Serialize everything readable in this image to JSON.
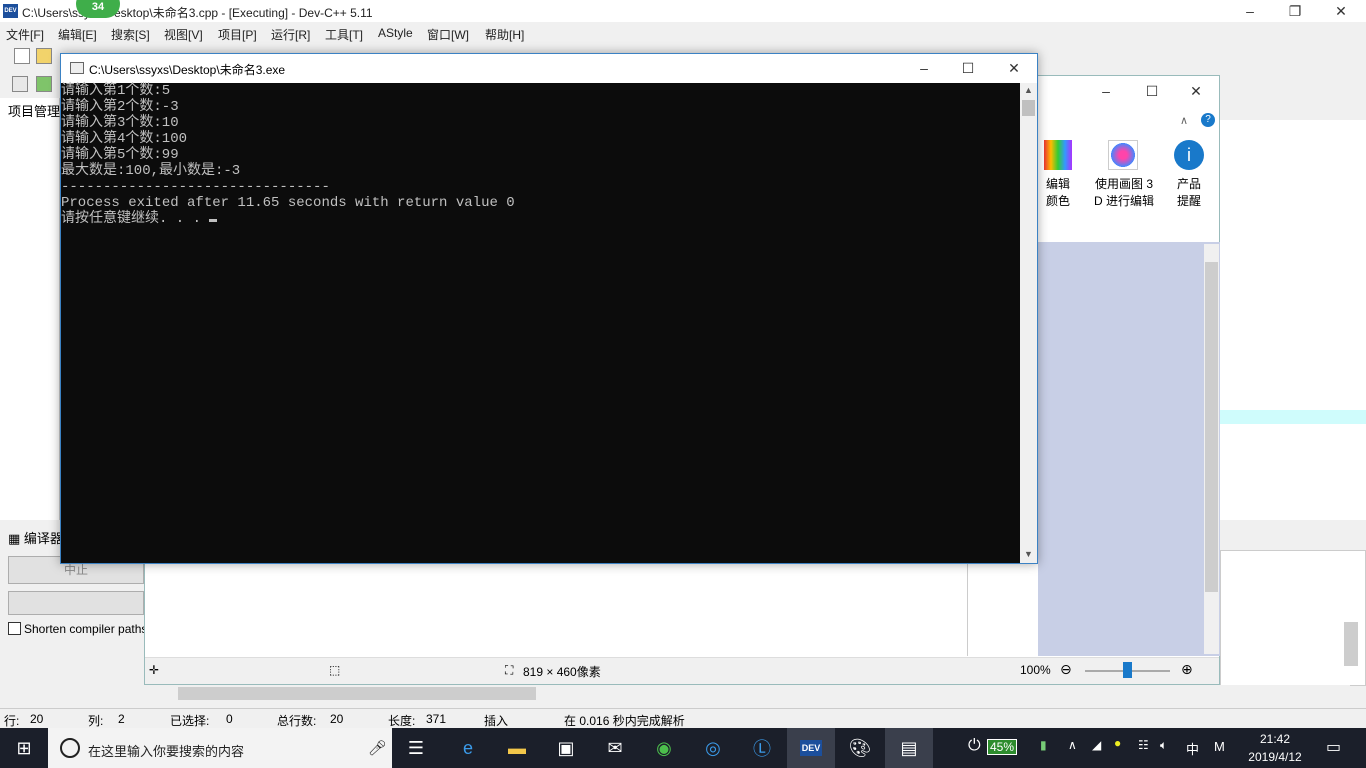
{
  "devcpp": {
    "title": "C:\\Users\\ssyxs\\Desktop\\未命名3.cpp - [Executing] - Dev-C++ 5.11",
    "badge": "34",
    "menu": [
      "文件[F]",
      "编辑[E]",
      "搜索[S]",
      "视图[V]",
      "项目[P]",
      "运行[R]",
      "工具[T]",
      "AStyle",
      "窗口[W]",
      "帮助[H]"
    ],
    "sidebar_label": "项目管理",
    "bottom_tab_label": "编译器",
    "stop_label": "中止",
    "shorten_label": "Shorten compiler paths",
    "status": {
      "row_label": "行:",
      "row": "20",
      "col_label": "列:",
      "col": "2",
      "sel_label": "已选择:",
      "sel": "0",
      "total_label": "总行数:",
      "total": "20",
      "len_label": "长度:",
      "len": "371",
      "mode": "插入",
      "parse": "在 0.016 秒内完成解析"
    }
  },
  "paint": {
    "ribbon": [
      {
        "label": "编辑\n颜色",
        "icon": "palette-icon"
      },
      {
        "label": "使用画图 3\nD 进行编辑",
        "icon": "paint3d-icon"
      },
      {
        "label": "产品\n提醒",
        "icon": "info-icon"
      }
    ],
    "size_text": "819 × 460像素",
    "zoom": "100%"
  },
  "console": {
    "title": "C:\\Users\\ssyxs\\Desktop\\未命名3.exe",
    "lines": [
      "请输入第1个数:5",
      "请输入第2个数:-3",
      "请输入第3个数:10",
      "请输入第4个数:100",
      "请输入第5个数:99",
      "最大数是:100,最小数是:-3",
      "--------------------------------",
      "Process exited after 11.65 seconds with return value 0",
      "请按任意键继续. . . "
    ]
  },
  "taskbar": {
    "search_placeholder": "在这里输入你要搜索的内容",
    "battery": "45%",
    "ime": "中",
    "ime_mode": "M",
    "time": "21:42",
    "date": "2019/4/12"
  }
}
